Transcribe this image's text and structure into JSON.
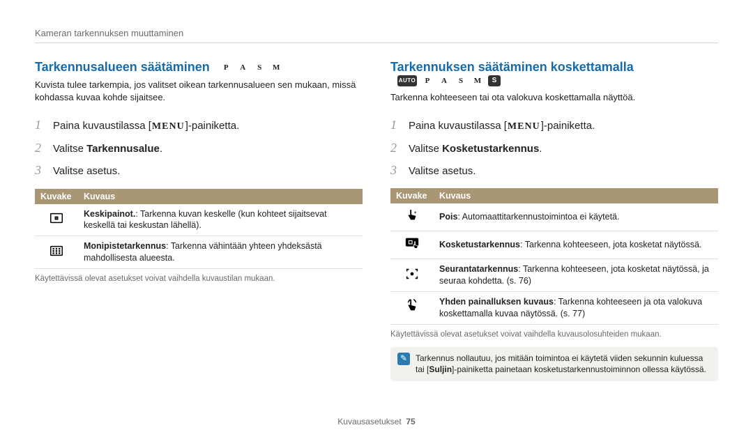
{
  "header": "Kameran tarkennuksen muuttaminen",
  "footer_label": "Kuvausasetukset",
  "footer_page": "75",
  "left": {
    "title": "Tarkennusalueen säätäminen",
    "modes": [
      "P",
      "A",
      "S",
      "M"
    ],
    "intro": "Kuvista tulee tarkempia, jos valitset oikean tarkennusalueen sen mukaan, missä kohdassa kuvaa kohde sijaitsee.",
    "steps": {
      "s1_pre": "Paina kuvaustilassa ",
      "s1_menu": "MENU",
      "s1_post": "-painiketta.",
      "s2_pre": "Valitse ",
      "s2_bold": "Tarkennusalue",
      "s2_post": ".",
      "s3": "Valitse asetus."
    },
    "table": {
      "th1": "Kuvake",
      "th2": "Kuvaus",
      "rows": [
        {
          "icon": "center-point-icon",
          "bold": "Keskipainot.",
          "rest": ": Tarkenna kuvan keskelle (kun kohteet sijaitsevat keskellä tai keskustan lähellä)."
        },
        {
          "icon": "multi-point-icon",
          "bold": "Monipistetarkennus",
          "rest": ": Tarkenna vähintään yhteen yhdeksästä mahdollisesta alueesta."
        }
      ]
    },
    "note": "Käytettävissä olevat asetukset voivat vaihdella kuvaustilan mukaan."
  },
  "right": {
    "title": "Tarkennuksen säätäminen koskettamalla",
    "modes": [
      "AUTO",
      "P",
      "A",
      "S",
      "M",
      "S"
    ],
    "intro": "Tarkenna kohteeseen tai ota valokuva koskettamalla näyttöä.",
    "steps": {
      "s1_pre": "Paina kuvaustilassa ",
      "s1_menu": "MENU",
      "s1_post": "-painiketta.",
      "s2_pre": "Valitse ",
      "s2_bold": "Kosketustarkennus",
      "s2_post": ".",
      "s3": "Valitse asetus."
    },
    "table": {
      "th1": "Kuvake",
      "th2": "Kuvaus",
      "rows": [
        {
          "icon": "touch-off-icon",
          "bold": "Pois",
          "rest": ": Automaattitarkennustoimintoa ei käytetä."
        },
        {
          "icon": "touch-af-icon",
          "bold": "Kosketustarkennus",
          "rest": ": Tarkenna kohteeseen, jota kosketat näytössä."
        },
        {
          "icon": "tracking-af-icon",
          "bold": "Seurantatarkennus",
          "rest": ": Tarkenna kohteeseen, jota kosketat näytössä, ja seuraa kohdetta. (s. 76)"
        },
        {
          "icon": "one-touch-shot-icon",
          "bold": "Yhden painalluksen kuvaus",
          "rest": ": Tarkenna kohteeseen ja ota valokuva koskettamalla kuvaa näytössä. (s. 77)"
        }
      ]
    },
    "note": "Käytettävissä olevat asetukset voivat vaihdella kuvausolosuhteiden mukaan.",
    "callout_pre": "Tarkennus nollautuu, jos mitään toimintoa ei käytetä viiden sekunnin kuluessa tai ",
    "callout_bold": "Suljin",
    "callout_post": "-painiketta painetaan kosketustarkennustoiminnon ollessa käytössä."
  }
}
